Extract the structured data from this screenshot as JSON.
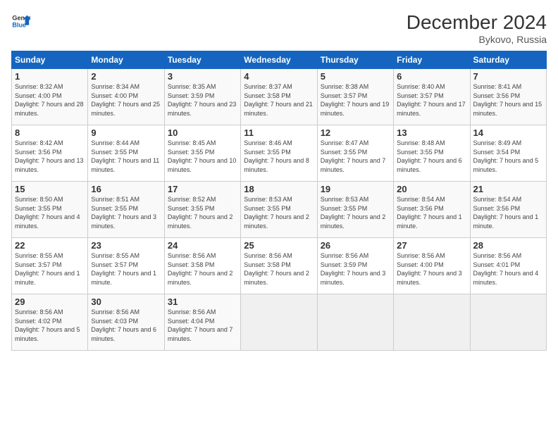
{
  "logo": {
    "line1": "General",
    "line2": "Blue"
  },
  "title": "December 2024",
  "subtitle": "Bykovo, Russia",
  "header": {
    "colors": {
      "bg": "#1565c0"
    }
  },
  "days_of_week": [
    "Sunday",
    "Monday",
    "Tuesday",
    "Wednesday",
    "Thursday",
    "Friday",
    "Saturday"
  ],
  "weeks": [
    [
      {
        "day": "1",
        "sunrise": "8:32 AM",
        "sunset": "4:00 PM",
        "daylight": "7 hours and 28 minutes."
      },
      {
        "day": "2",
        "sunrise": "8:34 AM",
        "sunset": "4:00 PM",
        "daylight": "7 hours and 25 minutes."
      },
      {
        "day": "3",
        "sunrise": "8:35 AM",
        "sunset": "3:59 PM",
        "daylight": "7 hours and 23 minutes."
      },
      {
        "day": "4",
        "sunrise": "8:37 AM",
        "sunset": "3:58 PM",
        "daylight": "7 hours and 21 minutes."
      },
      {
        "day": "5",
        "sunrise": "8:38 AM",
        "sunset": "3:57 PM",
        "daylight": "7 hours and 19 minutes."
      },
      {
        "day": "6",
        "sunrise": "8:40 AM",
        "sunset": "3:57 PM",
        "daylight": "7 hours and 17 minutes."
      },
      {
        "day": "7",
        "sunrise": "8:41 AM",
        "sunset": "3:56 PM",
        "daylight": "7 hours and 15 minutes."
      }
    ],
    [
      {
        "day": "8",
        "sunrise": "8:42 AM",
        "sunset": "3:56 PM",
        "daylight": "7 hours and 13 minutes."
      },
      {
        "day": "9",
        "sunrise": "8:44 AM",
        "sunset": "3:55 PM",
        "daylight": "7 hours and 11 minutes."
      },
      {
        "day": "10",
        "sunrise": "8:45 AM",
        "sunset": "3:55 PM",
        "daylight": "7 hours and 10 minutes."
      },
      {
        "day": "11",
        "sunrise": "8:46 AM",
        "sunset": "3:55 PM",
        "daylight": "7 hours and 8 minutes."
      },
      {
        "day": "12",
        "sunrise": "8:47 AM",
        "sunset": "3:55 PM",
        "daylight": "7 hours and 7 minutes."
      },
      {
        "day": "13",
        "sunrise": "8:48 AM",
        "sunset": "3:55 PM",
        "daylight": "7 hours and 6 minutes."
      },
      {
        "day": "14",
        "sunrise": "8:49 AM",
        "sunset": "3:54 PM",
        "daylight": "7 hours and 5 minutes."
      }
    ],
    [
      {
        "day": "15",
        "sunrise": "8:50 AM",
        "sunset": "3:55 PM",
        "daylight": "7 hours and 4 minutes."
      },
      {
        "day": "16",
        "sunrise": "8:51 AM",
        "sunset": "3:55 PM",
        "daylight": "7 hours and 3 minutes."
      },
      {
        "day": "17",
        "sunrise": "8:52 AM",
        "sunset": "3:55 PM",
        "daylight": "7 hours and 2 minutes."
      },
      {
        "day": "18",
        "sunrise": "8:53 AM",
        "sunset": "3:55 PM",
        "daylight": "7 hours and 2 minutes."
      },
      {
        "day": "19",
        "sunrise": "8:53 AM",
        "sunset": "3:55 PM",
        "daylight": "7 hours and 2 minutes."
      },
      {
        "day": "20",
        "sunrise": "8:54 AM",
        "sunset": "3:56 PM",
        "daylight": "7 hours and 1 minute."
      },
      {
        "day": "21",
        "sunrise": "8:54 AM",
        "sunset": "3:56 PM",
        "daylight": "7 hours and 1 minute."
      }
    ],
    [
      {
        "day": "22",
        "sunrise": "8:55 AM",
        "sunset": "3:57 PM",
        "daylight": "7 hours and 1 minute."
      },
      {
        "day": "23",
        "sunrise": "8:55 AM",
        "sunset": "3:57 PM",
        "daylight": "7 hours and 1 minute."
      },
      {
        "day": "24",
        "sunrise": "8:56 AM",
        "sunset": "3:58 PM",
        "daylight": "7 hours and 2 minutes."
      },
      {
        "day": "25",
        "sunrise": "8:56 AM",
        "sunset": "3:58 PM",
        "daylight": "7 hours and 2 minutes."
      },
      {
        "day": "26",
        "sunrise": "8:56 AM",
        "sunset": "3:59 PM",
        "daylight": "7 hours and 3 minutes."
      },
      {
        "day": "27",
        "sunrise": "8:56 AM",
        "sunset": "4:00 PM",
        "daylight": "7 hours and 3 minutes."
      },
      {
        "day": "28",
        "sunrise": "8:56 AM",
        "sunset": "4:01 PM",
        "daylight": "7 hours and 4 minutes."
      }
    ],
    [
      {
        "day": "29",
        "sunrise": "8:56 AM",
        "sunset": "4:02 PM",
        "daylight": "7 hours and 5 minutes."
      },
      {
        "day": "30",
        "sunrise": "8:56 AM",
        "sunset": "4:03 PM",
        "daylight": "7 hours and 6 minutes."
      },
      {
        "day": "31",
        "sunrise": "8:56 AM",
        "sunset": "4:04 PM",
        "daylight": "7 hours and 7 minutes."
      },
      null,
      null,
      null,
      null
    ]
  ]
}
